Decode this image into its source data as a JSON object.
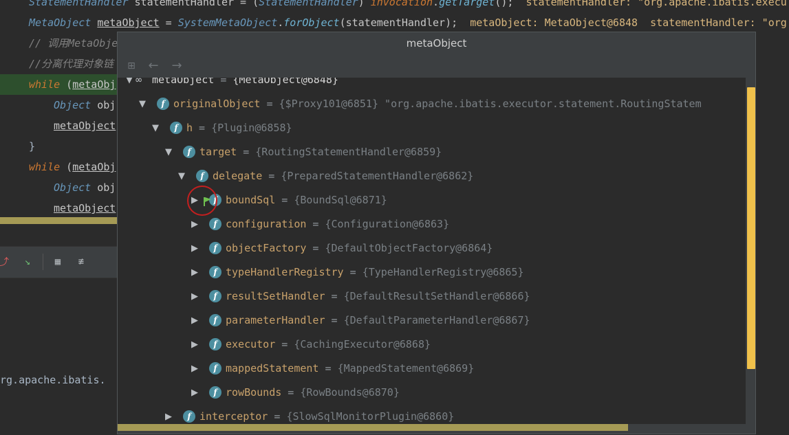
{
  "editor": {
    "lines": [
      {
        "id": "l0",
        "parts": [
          [
            "cls",
            "StatementHandler"
          ],
          [
            "plain",
            " statementHandler = ("
          ],
          [
            "cls",
            "StatementHandler"
          ],
          [
            "plain",
            ") "
          ],
          [
            "kw",
            "invocation"
          ],
          [
            "plain",
            "."
          ],
          [
            "fn",
            "getTarget"
          ],
          [
            "plain",
            "();  "
          ],
          [
            "hint",
            "statementHandler: \"org.apache.ibatis.execu"
          ]
        ]
      },
      {
        "id": "l1",
        "parts": [
          [
            "cls",
            "MetaObject"
          ],
          [
            "plain",
            " "
          ],
          [
            "var",
            "metaObject"
          ],
          [
            "plain",
            " = "
          ],
          [
            "cls",
            "SystemMetaObject"
          ],
          [
            "plain",
            "."
          ],
          [
            "fn",
            "forObject"
          ],
          [
            "plain",
            "(statementHandler);  "
          ],
          [
            "hint",
            "metaObject: MetaObject@6848  statementHandler: \"org."
          ]
        ]
      },
      {
        "id": "l2",
        "parts": [
          [
            "cmt",
            "// 调用MetaObje"
          ]
        ]
      },
      {
        "id": "l3",
        "parts": [
          [
            "cmt",
            "//分离代理对象链"
          ]
        ]
      },
      {
        "id": "l4",
        "parts": [
          [
            "kw",
            "while"
          ],
          [
            "plain",
            " ("
          ],
          [
            "var",
            "metaObj"
          ]
        ]
      },
      {
        "id": "l5",
        "parts": [
          [
            "cls",
            "Object"
          ],
          [
            "plain",
            " obj"
          ]
        ]
      },
      {
        "id": "l6",
        "parts": [
          [
            "var",
            "metaObject"
          ]
        ]
      },
      {
        "id": "l7",
        "parts": [
          [
            "brace",
            "}"
          ]
        ]
      },
      {
        "id": "l8",
        "parts": [
          [
            "kw",
            "while"
          ],
          [
            "plain",
            " ("
          ],
          [
            "var",
            "metaObj"
          ]
        ]
      },
      {
        "id": "l9",
        "parts": [
          [
            "cls",
            "Object"
          ],
          [
            "plain",
            " obj"
          ]
        ]
      },
      {
        "id": "l10",
        "parts": [
          [
            "var",
            "metaObject"
          ]
        ]
      }
    ],
    "lower_text": "rg.apache.ibatis."
  },
  "popup": {
    "title": "metaObject",
    "toolbar": {
      "back": "←",
      "forward": "→"
    },
    "root": {
      "name": "metaObject",
      "value": "{MetaObject@6848}"
    },
    "rows": [
      {
        "name": "originalObject",
        "value": "{$Proxy101@6851} \"org.apache.ibatis.executor.statement.RoutingStatem",
        "arrow": "▼",
        "level": 1
      },
      {
        "name": "h",
        "value": "{Plugin@6858}",
        "arrow": "▼",
        "level": 2
      },
      {
        "name": "target",
        "value": "{RoutingStatementHandler@6859}",
        "arrow": "▼",
        "level": 3
      },
      {
        "name": "delegate",
        "value": "{PreparedStatementHandler@6862}",
        "arrow": "▼",
        "level": 4
      },
      {
        "name": "boundSql",
        "value": "{BoundSql@6871}",
        "arrow": "▶",
        "level": 5,
        "flag": true
      },
      {
        "name": "configuration",
        "value": "{Configuration@6863}",
        "arrow": "▶",
        "level": 5
      },
      {
        "name": "objectFactory",
        "value": "{DefaultObjectFactory@6864}",
        "arrow": "▶",
        "level": 5
      },
      {
        "name": "typeHandlerRegistry",
        "value": "{TypeHandlerRegistry@6865}",
        "arrow": "▶",
        "level": 5
      },
      {
        "name": "resultSetHandler",
        "value": "{DefaultResultSetHandler@6866}",
        "arrow": "▶",
        "level": 5
      },
      {
        "name": "parameterHandler",
        "value": "{DefaultParameterHandler@6867}",
        "arrow": "▶",
        "level": 5
      },
      {
        "name": "executor",
        "value": "{CachingExecutor@6868}",
        "arrow": "▶",
        "level": 5
      },
      {
        "name": "mappedStatement",
        "value": "{MappedStatement@6869}",
        "arrow": "▶",
        "level": 5
      },
      {
        "name": "rowBounds",
        "value": "{RowBounds@6870}",
        "arrow": "▶",
        "level": 5
      },
      {
        "name": "interceptor",
        "value": "{SlowSqlMonitorPlugin@6860}",
        "arrow": "▶",
        "level": 3
      }
    ]
  },
  "colors": {
    "scrollbar": "#f0c14b",
    "highlight_circle": "#c41f1f",
    "field_icon": "#4d8fa0"
  }
}
